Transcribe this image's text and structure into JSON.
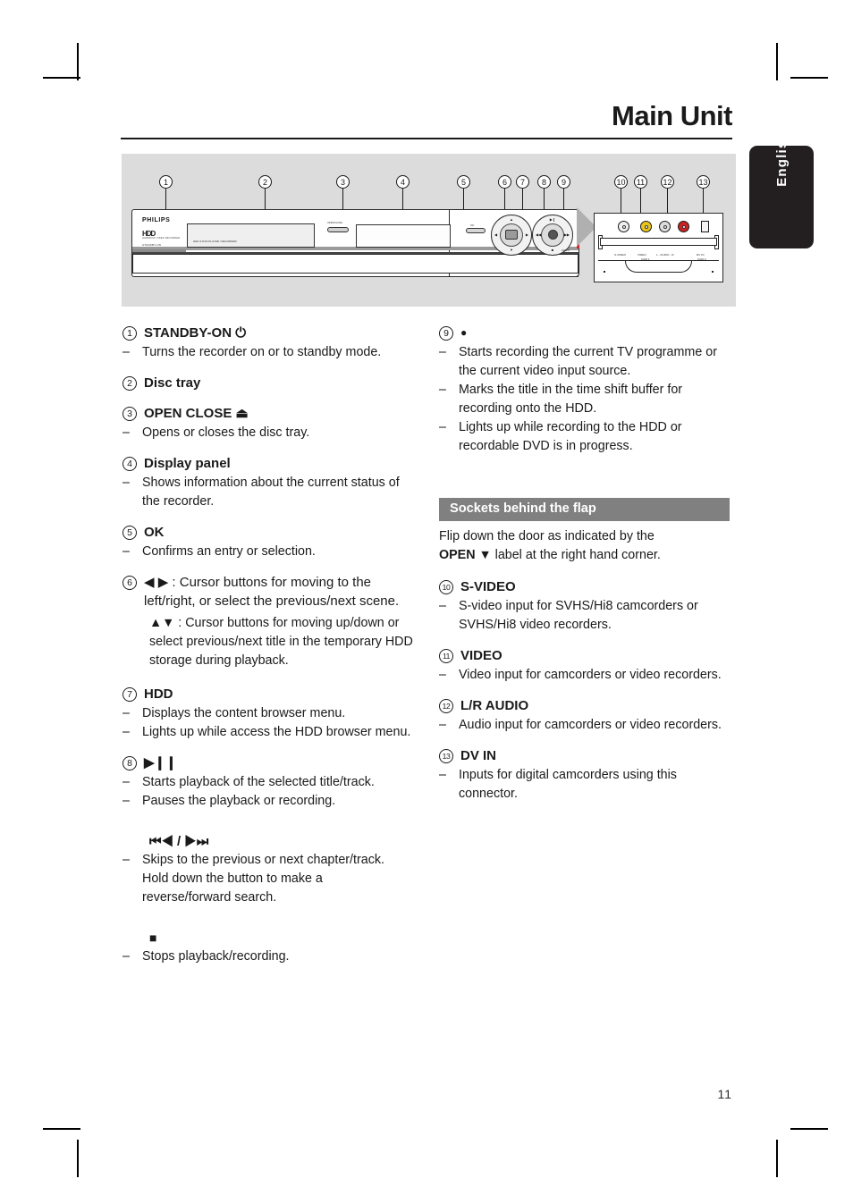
{
  "page": {
    "title": "Main Unit",
    "language_tab": "English",
    "page_number": "11"
  },
  "figure": {
    "brand": "PHILIPS",
    "hdd_logo": "HDD",
    "hdd_sub": "HARDDISK VIDEO RECORDER",
    "standby_label": "STANDBY-ON",
    "tray_label": "HDD & DVD PLAYER / RECORDER",
    "openclose_label": "OPEN/CLOSE",
    "ok_label": "OK",
    "open_tag": "OPEN",
    "callouts": [
      "1",
      "2",
      "3",
      "4",
      "5",
      "6",
      "7",
      "8",
      "9",
      "10",
      "11",
      "12",
      "13"
    ],
    "socket_labels": [
      "S-VIDEO",
      "VIDEO",
      "L - AUDIO - R",
      "DV IN"
    ],
    "socket_sub_labels": [
      "CAM 1",
      "CAM 2"
    ]
  },
  "left_column": [
    {
      "num": "1",
      "title": "STANDBY-ON",
      "glyph": "⏻",
      "bullets": [
        "Turns the recorder on or to standby mode."
      ]
    },
    {
      "num": "2",
      "title": "Disc tray",
      "glyph": "",
      "bullets": []
    },
    {
      "num": "3",
      "title": "OPEN CLOSE",
      "glyph": "⏏",
      "bullets": [
        "Opens or closes the disc tray."
      ]
    },
    {
      "num": "4",
      "title": "Display panel",
      "glyph": "",
      "bullets": [
        "Shows information about the current status of the recorder."
      ]
    },
    {
      "num": "5",
      "title": "OK",
      "glyph": "",
      "bullets": [
        "Confirms an entry or selection."
      ]
    },
    {
      "num": "6",
      "title": "",
      "glyph": "◀ ▶",
      "para1": "◀ ▶ : Cursor buttons for moving to the left/right, or select the previous/next scene.",
      "para2": "▲▼ : Cursor buttons for moving up/down or select previous/next title in the temporary HDD storage during playback.",
      "bullets": []
    },
    {
      "num": "7",
      "title": "HDD",
      "glyph": "",
      "bullets": [
        "Displays the content browser menu.",
        "Lights up while access the HDD browser menu."
      ]
    },
    {
      "num": "8",
      "title": "",
      "glyph": "▶❙❙",
      "bullets": [
        "Starts playback of the selected title/track.",
        "Pauses the playback or recording."
      ],
      "sub_glyph_1": "⏮◀ / ▶⏭",
      "sub_bullets_1": [
        "Skips to the previous or next chapter/track.  Hold down the button to make a reverse/forward search."
      ],
      "sub_glyph_2": "■",
      "sub_bullets_2": [
        "Stops playback/recording."
      ]
    }
  ],
  "right_column": {
    "item9": {
      "num": "9",
      "title": "",
      "glyph": "●",
      "bullets": [
        "Starts recording the current TV programme or the current video input source.",
        "Marks the title in the time shift buffer for recording onto the HDD.",
        "Lights up while recording to the HDD or recordable DVD is in progress."
      ]
    },
    "banner": "Sockets behind the flap",
    "banner_text_1": "Flip down the door as indicated by the",
    "banner_text_2_bold": "OPEN",
    "banner_text_2_glyph": "▼",
    "banner_text_2_rest": "label at the right hand corner.",
    "items": [
      {
        "num": "10",
        "title": "S-VIDEO",
        "glyph": "",
        "bullets": [
          "S-video input for SVHS/Hi8 camcorders or SVHS/Hi8 video recorders."
        ]
      },
      {
        "num": "11",
        "title": "VIDEO",
        "glyph": "",
        "bullets": [
          "Video input for camcorders or video recorders."
        ]
      },
      {
        "num": "12",
        "title": "L/R AUDIO",
        "glyph": "",
        "bullets": [
          "Audio input for camcorders or video recorders."
        ]
      },
      {
        "num": "13",
        "title": "DV IN",
        "glyph": "",
        "bullets": [
          "Inputs for digital camcorders using this connector."
        ]
      }
    ]
  },
  "colors": {
    "figure_bg": "#dcdcdc",
    "banner_bg": "#808080",
    "lang_tab_bg": "#231f20",
    "accent_red": "#d92121",
    "text": "#1a1a1a"
  }
}
